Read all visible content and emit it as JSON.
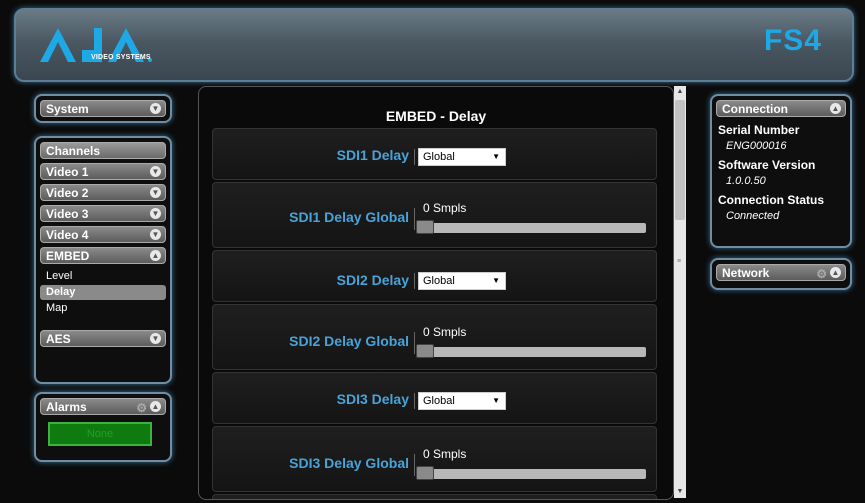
{
  "header": {
    "brand": "AJA",
    "brand_sub": "VIDEO SYSTEMS",
    "model": "FS4"
  },
  "left": {
    "system": "System",
    "channels": "Channels",
    "items": [
      {
        "label": "Video 1"
      },
      {
        "label": "Video 2"
      },
      {
        "label": "Video 3"
      },
      {
        "label": "Video 4"
      }
    ],
    "embed": "EMBED",
    "embed_sub": [
      {
        "label": "Level"
      },
      {
        "label": "Delay"
      },
      {
        "label": "Map"
      }
    ],
    "aes": "AES",
    "alarms": "Alarms",
    "alarm_status": "None"
  },
  "center": {
    "title": "EMBED - Delay",
    "rows": [
      {
        "label": "SDI1 Delay",
        "value": "Global"
      },
      {
        "label": "SDI1 Delay Global",
        "value": "0 Smpls",
        "level": 0
      },
      {
        "label": "SDI2 Delay",
        "value": "Global"
      },
      {
        "label": "SDI2 Delay Global",
        "value": "0 Smpls",
        "level": 0
      },
      {
        "label": "SDI3 Delay",
        "value": "Global"
      },
      {
        "label": "SDI3 Delay Global",
        "value": "0 Smpls",
        "level": 0
      }
    ]
  },
  "right": {
    "connection": "Connection",
    "serial_label": "Serial Number",
    "serial_value": "ENG000016",
    "sw_label": "Software Version",
    "sw_value": "1.0.0.50",
    "status_label": "Connection Status",
    "status_value": "Connected",
    "network": "Network"
  },
  "colors": {
    "accent": "#4aa3d8",
    "brand": "#1ea8e6",
    "alarm": "#0f7a0f"
  }
}
